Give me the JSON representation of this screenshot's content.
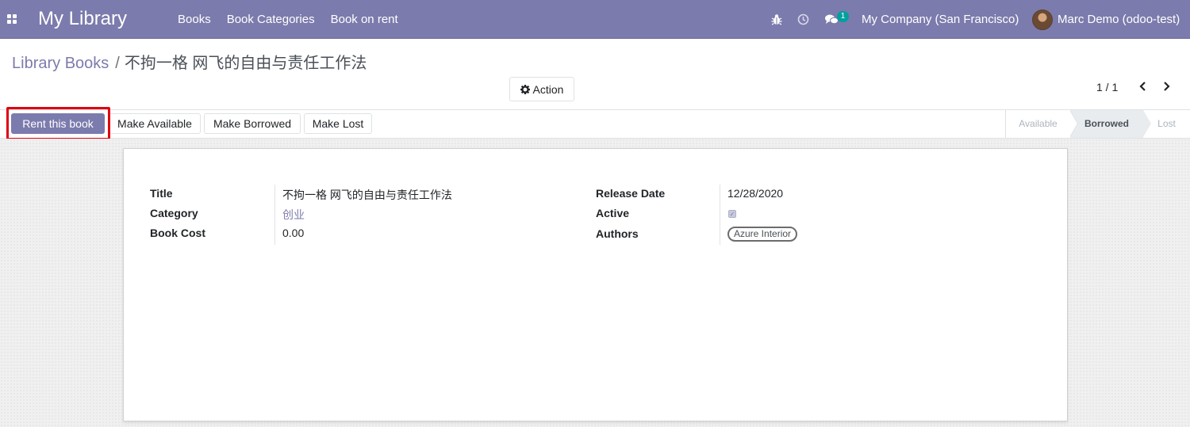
{
  "navbar": {
    "app_name": "My Library",
    "menu": [
      "Books",
      "Book Categories",
      "Book on rent"
    ],
    "chat_count": "1",
    "company": "My Company (San Francisco)",
    "user": "Marc Demo (odoo-test)",
    "icons": [
      "apps-icon",
      "bug-icon",
      "clock-icon",
      "chat-icon",
      "avatar"
    ]
  },
  "breadcrumb": {
    "parent": "Library Books",
    "separator": "/",
    "current": "不拘一格 网飞的自由与责任工作法"
  },
  "control_panel": {
    "action_label": "Action",
    "pager_value": "1 / 1"
  },
  "statusbar": {
    "buttons": [
      "Rent this book",
      "Make Available",
      "Make Borrowed",
      "Make Lost"
    ],
    "stages": [
      "Available",
      "Borrowed",
      "Lost"
    ],
    "current_stage": "Borrowed"
  },
  "form": {
    "title_label": "Title",
    "title_value": "不拘一格 网飞的自由与责任工作法",
    "category_label": "Category",
    "category_value": "创业",
    "cost_label": "Book Cost",
    "cost_value": "0.00",
    "release_label": "Release Date",
    "release_value": "12/28/2020",
    "active_label": "Active",
    "active_checked": true,
    "authors_label": "Authors",
    "authors": [
      "Azure Interior"
    ]
  },
  "colors": {
    "brand": "#7c7bad",
    "highlight": "#e0000f",
    "badge": "#00a09d"
  }
}
